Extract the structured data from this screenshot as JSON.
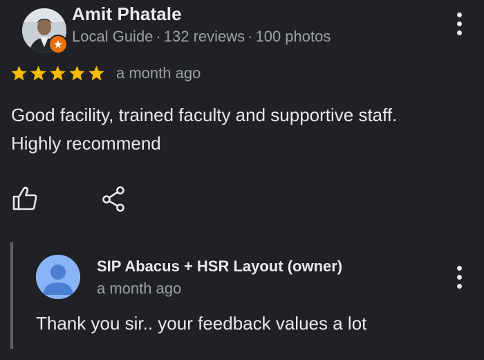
{
  "review": {
    "reviewer_name": "Amit Phatale",
    "reviewer_role": "Local Guide",
    "reviews_count": "132 reviews",
    "photos_count": "100 photos",
    "separator": "·",
    "rating": 5,
    "rating_max": 5,
    "time_ago": "a month ago",
    "text_line1": "Good facility, trained faculty and supportive staff.",
    "text_line2": "Highly recommend"
  },
  "owner_reply": {
    "name": "SIP Abacus + HSR Layout (owner)",
    "time_ago": "a month ago",
    "text": "Thank you sir.. your feedback values a lot"
  },
  "colors": {
    "background": "#202124",
    "primary_text": "#e8eaed",
    "secondary_text": "#9aa0a6",
    "star": "#fbbc04",
    "local_guide_badge": "#e8710a",
    "owner_avatar": "#8ab4f8",
    "reply_bar": "#5f6368"
  },
  "icons": {
    "more": "more-vert-icon",
    "like": "thumb-up-icon",
    "share": "share-icon",
    "badge": "local-guide-star-icon"
  }
}
